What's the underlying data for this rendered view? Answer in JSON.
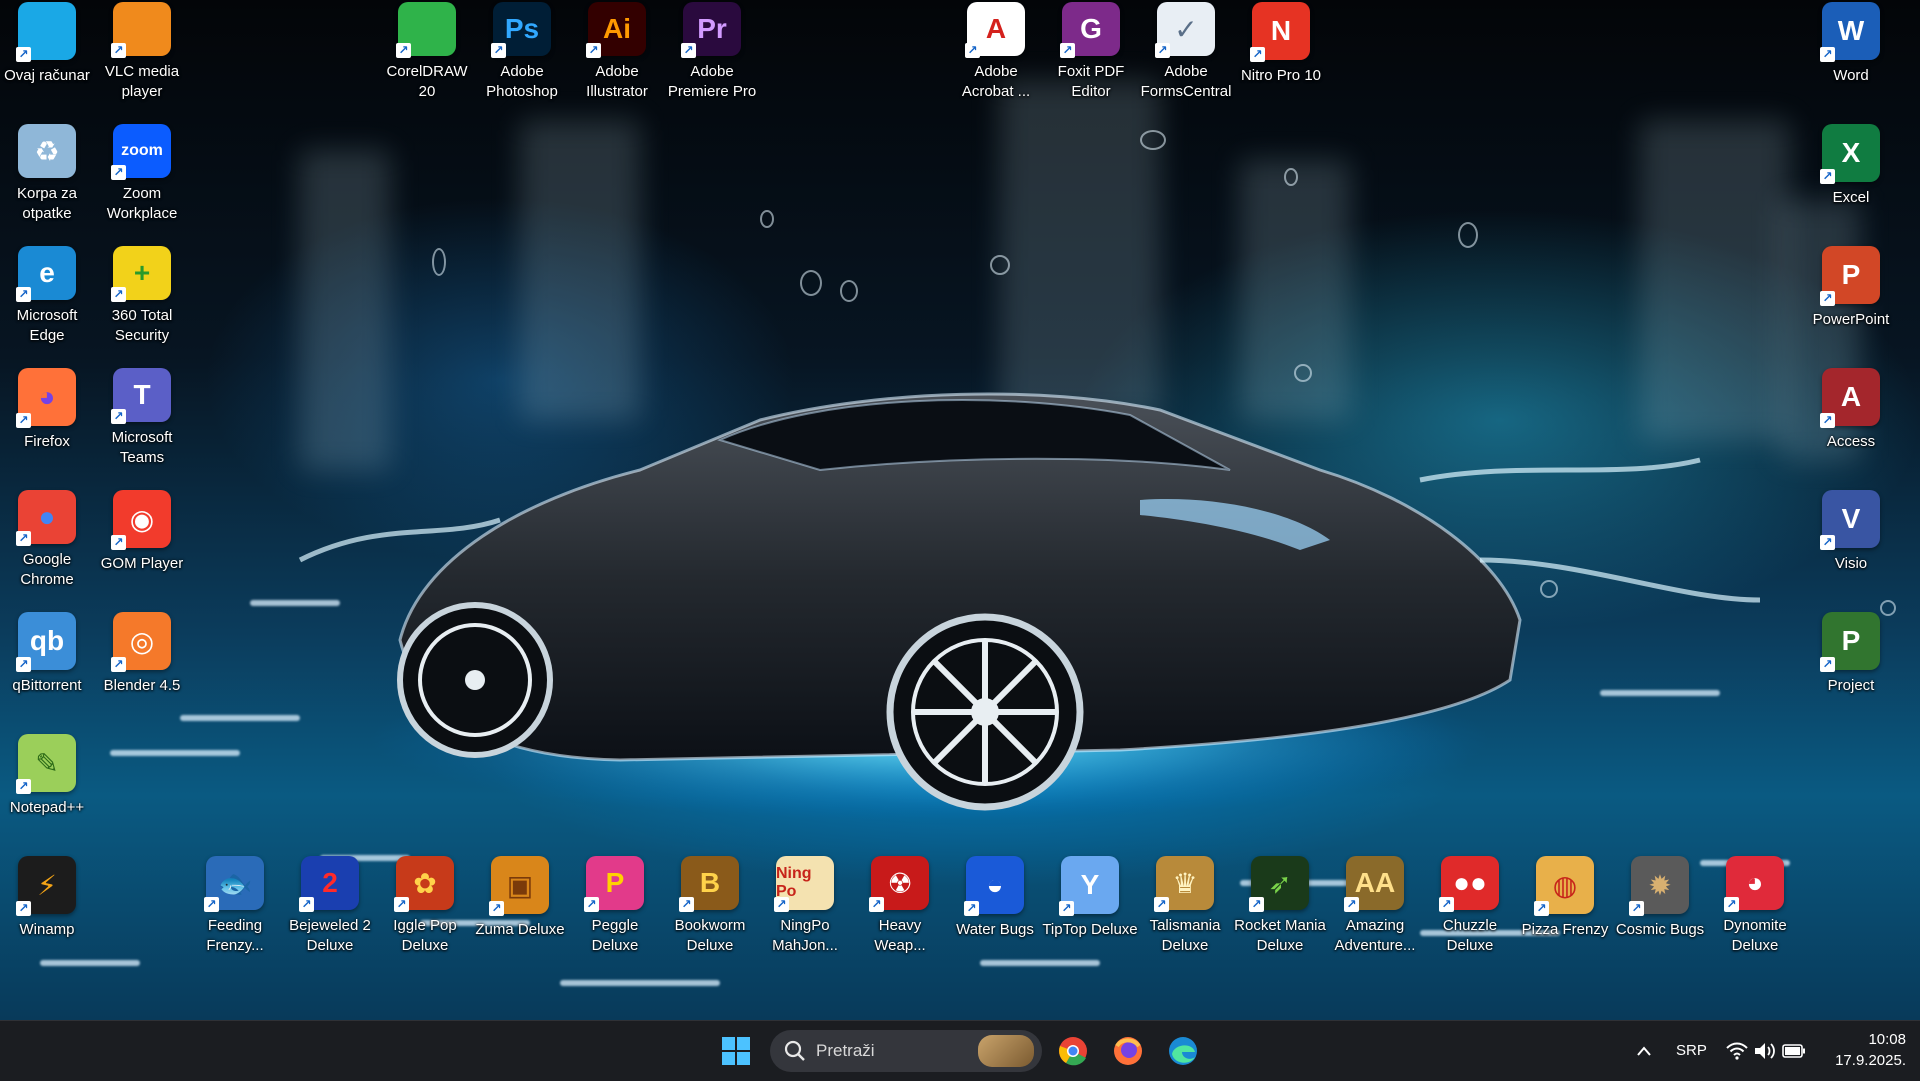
{
  "desktop": {
    "icons": [
      {
        "label": "Ovaj računar",
        "icon": "computer-icon",
        "color": "#1aa8e6"
      },
      {
        "label": "VLC media player",
        "icon": "vlc-cone-icon",
        "color": "#f08a1c"
      },
      {
        "label": "CorelDRAW 20",
        "icon": "coreldraw-icon",
        "color": "#2fb34a"
      },
      {
        "label": "Adobe Photoshop",
        "icon": "photoshop-icon",
        "color": "#001e36",
        "glyph": "Ps",
        "glyph_color": "#31a8ff"
      },
      {
        "label": "Adobe Illustrator",
        "icon": "illustrator-icon",
        "color": "#330000",
        "glyph": "Ai",
        "glyph_color": "#ff9a00"
      },
      {
        "label": "Adobe Premiere Pro",
        "icon": "premiere-icon",
        "color": "#2a0a3e",
        "glyph": "Pr",
        "glyph_color": "#d29bff"
      },
      {
        "label": "Adobe Acrobat ...",
        "icon": "acrobat-icon",
        "color": "#ffffff",
        "glyph": "A",
        "glyph_color": "#d4211d"
      },
      {
        "label": "Foxit PDF Editor",
        "icon": "foxit-pdf-icon",
        "color": "#7d2a8a",
        "glyph": "G",
        "glyph_color": "#ffffff"
      },
      {
        "label": "Adobe FormsCentral",
        "icon": "formscentral-icon",
        "color": "#e8eef4",
        "glyph": "✓",
        "glyph_color": "#5a6f88"
      },
      {
        "label": "Nitro Pro 10",
        "icon": "nitro-icon",
        "color": "#e63323",
        "glyph": "N",
        "glyph_color": "#ffffff"
      },
      {
        "label": "Word",
        "icon": "word-icon",
        "color": "#1b5eb8",
        "glyph": "W",
        "glyph_color": "#ffffff"
      },
      {
        "label": "Korpa za otpatke",
        "icon": "recycle-bin-icon",
        "color": "#8fb7d8",
        "glyph": "♻",
        "glyph_color": "#ffffff"
      },
      {
        "label": "Zoom Workplace",
        "icon": "zoom-icon",
        "color": "#0b5cff",
        "glyph": "zoom",
        "glyph_color": "#ffffff"
      },
      {
        "label": "Excel",
        "icon": "excel-icon",
        "color": "#107c41",
        "glyph": "X",
        "glyph_color": "#ffffff"
      },
      {
        "label": "Microsoft Edge",
        "icon": "edge-icon",
        "color": "#1a8ad4",
        "glyph": "e",
        "glyph_color": "#ffffff"
      },
      {
        "label": "360 Total Security",
        "icon": "360-security-icon",
        "color": "#f2d21a",
        "glyph": "+",
        "glyph_color": "#2a9a2a"
      },
      {
        "label": "PowerPoint",
        "icon": "powerpoint-icon",
        "color": "#d24726",
        "glyph": "P",
        "glyph_color": "#ffffff"
      },
      {
        "label": "Firefox",
        "icon": "firefox-icon",
        "color": "#ff7139",
        "glyph": "◕",
        "glyph_color": "#7542e5"
      },
      {
        "label": "Microsoft Teams",
        "icon": "teams-icon",
        "color": "#5b5fc7",
        "glyph": "T",
        "glyph_color": "#ffffff"
      },
      {
        "label": "Access",
        "icon": "access-icon",
        "color": "#a4262c",
        "glyph": "A",
        "glyph_color": "#ffffff"
      },
      {
        "label": "Google Chrome",
        "icon": "chrome-icon",
        "color": "#ea4335",
        "glyph": "●",
        "glyph_color": "#4285f4"
      },
      {
        "label": "GOM Player",
        "icon": "gom-player-icon",
        "color": "#f23b2c",
        "glyph": "◉",
        "glyph_color": "#ffffff"
      },
      {
        "label": "Visio",
        "icon": "visio-icon",
        "color": "#3955a3",
        "glyph": "V",
        "glyph_color": "#ffffff"
      },
      {
        "label": "qBittorrent",
        "icon": "qbittorrent-icon",
        "color": "#3b8ed8",
        "glyph": "qb",
        "glyph_color": "#ffffff"
      },
      {
        "label": "Blender 4.5",
        "icon": "blender-icon",
        "color": "#f5792a",
        "glyph": "◎",
        "glyph_color": "#ffffff"
      },
      {
        "label": "Project",
        "icon": "project-icon",
        "color": "#31752f",
        "glyph": "P",
        "glyph_color": "#ffffff"
      },
      {
        "label": "Notepad++",
        "icon": "notepad-plus-plus-icon",
        "color": "#9bcf5a",
        "glyph": "✎",
        "glyph_color": "#2d6b18"
      },
      {
        "label": "Winamp",
        "icon": "winamp-icon",
        "color": "#1c1c1c",
        "glyph": "⚡",
        "glyph_color": "#f4a416"
      },
      {
        "label": "Feeding Frenzy...",
        "icon": "feeding-frenzy-icon",
        "color": "#2a6bb8",
        "glyph": "🐟",
        "glyph_color": "#ffffff"
      },
      {
        "label": "Bejeweled 2 Deluxe",
        "icon": "bejeweled-icon",
        "color": "#1a3fb0",
        "glyph": "2",
        "glyph_color": "#ff2a2a"
      },
      {
        "label": "Iggle Pop Deluxe",
        "icon": "iggle-pop-icon",
        "color": "#c73a1a",
        "glyph": "✿",
        "glyph_color": "#ffd24a"
      },
      {
        "label": "Zuma Deluxe",
        "icon": "zuma-icon",
        "color": "#d9861a",
        "glyph": "▣",
        "glyph_color": "#7a3a0a"
      },
      {
        "label": "Peggle Deluxe",
        "icon": "peggle-icon",
        "color": "#e23a8a",
        "glyph": "P",
        "glyph_color": "#ffd200"
      },
      {
        "label": "Bookworm Deluxe",
        "icon": "bookworm-icon",
        "color": "#8a5a1a",
        "glyph": "B",
        "glyph_color": "#ffd24a"
      },
      {
        "label": "NingPo MahJon...",
        "icon": "ningpo-mahjong-icon",
        "color": "#f4e2b0",
        "glyph": "Ning Po",
        "glyph_color": "#c7241a"
      },
      {
        "label": "Heavy Weap...",
        "icon": "heavy-weapon-icon",
        "color": "#c81a1a",
        "glyph": "☢",
        "glyph_color": "#ffffff"
      },
      {
        "label": "Water Bugs",
        "icon": "water-bugs-icon",
        "color": "#1a5ad8",
        "glyph": "◒",
        "glyph_color": "#ffffff"
      },
      {
        "label": "TipTop Deluxe",
        "icon": "tiptop-icon",
        "color": "#6aa8f0",
        "glyph": "Y",
        "glyph_color": "#ffffff"
      },
      {
        "label": "Talismania Deluxe",
        "icon": "talismania-icon",
        "color": "#b88a3a",
        "glyph": "♛",
        "glyph_color": "#fff3c0"
      },
      {
        "label": "Rocket Mania Deluxe",
        "icon": "rocket-mania-icon",
        "color": "#1a3a1a",
        "glyph": "➶",
        "glyph_color": "#7ad44a"
      },
      {
        "label": "Amazing Adventure...",
        "icon": "amazing-adventures-icon",
        "color": "#8a6a2a",
        "glyph": "AA",
        "glyph_color": "#ffe08a"
      },
      {
        "label": "Chuzzle Deluxe",
        "icon": "chuzzle-icon",
        "color": "#e02a2a",
        "glyph": "●●",
        "glyph_color": "#ffffff"
      },
      {
        "label": "Pizza Frenzy",
        "icon": "pizza-frenzy-icon",
        "color": "#e8b04a",
        "glyph": "◍",
        "glyph_color": "#c7241a"
      },
      {
        "label": "Cosmic Bugs",
        "icon": "cosmic-bugs-icon",
        "color": "#5a5a5a",
        "glyph": "✹",
        "glyph_color": "#d8b070"
      },
      {
        "label": "Dynomite Deluxe",
        "icon": "dynomite-icon",
        "color": "#e02a3a",
        "glyph": "◕",
        "glyph_color": "#ffffff"
      }
    ]
  },
  "taskbar": {
    "start_icon": "windows-start-icon",
    "search_placeholder": "Pretraži",
    "pinned": [
      {
        "name": "chrome",
        "icon": "chrome-icon"
      },
      {
        "name": "firefox",
        "icon": "firefox-icon"
      },
      {
        "name": "edge",
        "icon": "edge-icon"
      }
    ],
    "tray": {
      "language": "SRP",
      "time": "10:08",
      "date": "17.9.2025."
    }
  }
}
